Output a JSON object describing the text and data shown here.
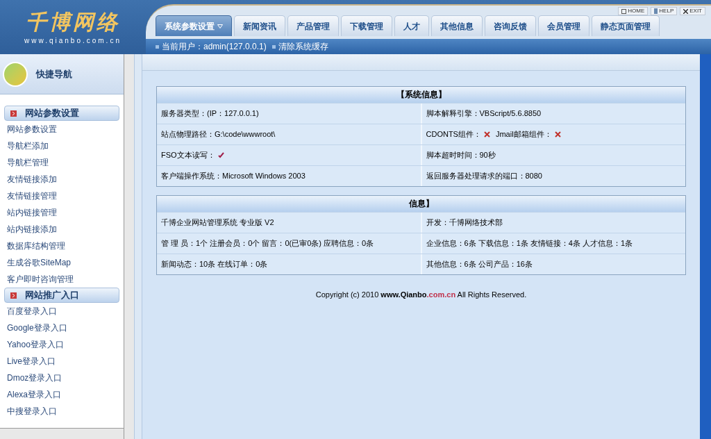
{
  "logo": {
    "title": "千博网络",
    "url": "www.qianbo.com.cn"
  },
  "top_links": [
    "HOME",
    "HELP",
    "EXIT"
  ],
  "tabs": [
    {
      "label": "系统参数设置",
      "selected": true,
      "dropdown": true
    },
    {
      "label": "新闻资讯",
      "selected": false,
      "dropdown": false
    },
    {
      "label": "产品管理",
      "selected": false,
      "dropdown": false
    },
    {
      "label": "下载管理",
      "selected": false,
      "dropdown": false
    },
    {
      "label": "人才",
      "selected": false,
      "dropdown": false
    },
    {
      "label": "其他信息",
      "selected": false,
      "dropdown": false
    },
    {
      "label": "咨询反馈",
      "selected": false,
      "dropdown": false
    },
    {
      "label": "会员管理",
      "selected": false,
      "dropdown": false
    },
    {
      "label": "静态页面管理",
      "selected": false,
      "dropdown": false
    }
  ],
  "sub_bar": [
    "当前用户：admin(127.0.0.1)",
    "清除系统缓存"
  ],
  "sidebar": {
    "title": "快捷导航",
    "groups": [
      {
        "title": "网站参数设置",
        "items": [
          "网站参数设置",
          "导航栏添加",
          "导航栏管理",
          "友情链接添加",
          "友情链接管理",
          "站内链接管理",
          "站内链接添加",
          "数据库结构管理",
          "生成谷歌SiteMap",
          "客户即时咨询管理"
        ]
      },
      {
        "title": "网站推广入口",
        "items": [
          "百度登录入口",
          "Google登录入口",
          "Yahoo登录入口",
          "Live登录入口",
          "Dmoz登录入口",
          "Alexa登录入口",
          "中搜登录入口"
        ]
      }
    ]
  },
  "panels": [
    {
      "title": "【系统信息】",
      "rows": [
        [
          {
            "parts": [
              {
                "label": "服务器类型：(IP：127.0.0.1)"
              }
            ]
          },
          {
            "parts": [
              {
                "label": "脚本解释引擎：VBScript/5.6.8850"
              }
            ]
          }
        ],
        [
          {
            "parts": [
              {
                "label": "站点物理路径：G:\\code\\wwwroot\\"
              }
            ]
          },
          {
            "parts": [
              {
                "label": "CDONTS组件：",
                "ok": false
              },
              {
                "label": "Jmail邮箱组件：",
                "ok": false
              }
            ]
          }
        ],
        [
          {
            "parts": [
              {
                "label": "FSO文本读写：",
                "ok": true
              }
            ]
          },
          {
            "parts": [
              {
                "label": "脚本超时时间：90秒"
              }
            ]
          }
        ],
        [
          {
            "parts": [
              {
                "label": "客户端操作系统：Microsoft Windows 2003"
              }
            ]
          },
          {
            "parts": [
              {
                "label": "返回服务器处理请求的端口：8080"
              }
            ]
          }
        ]
      ]
    },
    {
      "title": "信息】",
      "rows": [
        [
          {
            "parts": [
              {
                "label": "千博企业网站管理系统 专业版 V2"
              }
            ]
          },
          {
            "parts": [
              {
                "label": "开发：千博网络技术部"
              }
            ]
          }
        ],
        [
          {
            "parts": [
              {
                "label": "管 理 员：1个 注册会员：0个 留言：0(已审0条) 应聘信息：0条"
              }
            ]
          },
          {
            "parts": [
              {
                "label": "企业信息：6条 下载信息：1条 友情链接：4条 人才信息：1条"
              }
            ]
          }
        ],
        [
          {
            "parts": [
              {
                "label": "新闻动态：10条 在线订单：0条"
              }
            ]
          },
          {
            "parts": [
              {
                "label": "其他信息：6条 公司产品：16条"
              }
            ]
          }
        ]
      ]
    }
  ],
  "footer": {
    "prefix": "Copyright (c) 2010",
    "site": "www.Qianbo",
    "domain": ".com.cn",
    "suffix": "All Rights Reserved."
  }
}
